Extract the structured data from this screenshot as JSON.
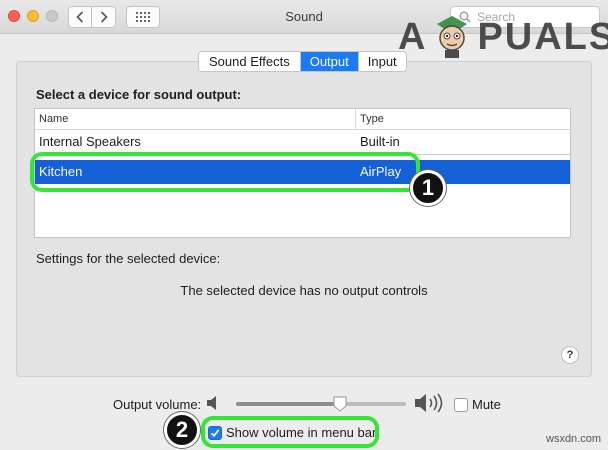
{
  "window": {
    "title": "Sound",
    "search_placeholder": "Search"
  },
  "watermark": {
    "left": "A",
    "right": "PUALS"
  },
  "tabs": [
    {
      "label": "Sound Effects",
      "active": false
    },
    {
      "label": "Output",
      "active": true
    },
    {
      "label": "Input",
      "active": false
    }
  ],
  "output": {
    "select_label": "Select a device for sound output:",
    "columns": {
      "name": "Name",
      "type": "Type"
    },
    "devices": [
      {
        "name": "Internal Speakers",
        "type": "Built-in",
        "selected": false
      },
      {
        "name": "Kitchen",
        "type": "AirPlay",
        "selected": true
      }
    ],
    "settings_label": "Settings for the selected device:",
    "no_controls_message": "The selected device has no output controls",
    "help_label": "?"
  },
  "volume": {
    "label": "Output volume:",
    "level": 0.61,
    "mute_label": "Mute",
    "mute_checked": false,
    "show_in_menu_bar_label": "Show volume in menu bar",
    "show_in_menu_bar_checked": true
  },
  "annotations": {
    "badge_1": "1",
    "badge_2": "2",
    "ring_color": "#36e636"
  },
  "footer_watermark": "wsxdn.com",
  "colors": {
    "accent": "#1a7bf2",
    "selection": "#1460d6"
  }
}
